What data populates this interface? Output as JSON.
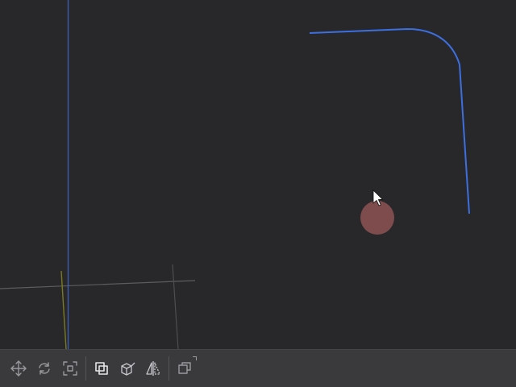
{
  "viewport": {
    "background": "#28282a",
    "axis_colors": {
      "z_axis": "#3a5db0",
      "y_axis": "#7a7a2a",
      "grid": "#5a5a5c"
    },
    "curve_color": "#3c6fe0",
    "click_marker_color": "#a05a5a"
  },
  "toolbar": {
    "tools": [
      {
        "name": "move-tool",
        "icon": "move-icon",
        "active": false
      },
      {
        "name": "rotate-tool",
        "icon": "rotate-icon",
        "active": false
      },
      {
        "name": "scale-tool",
        "icon": "scale-icon",
        "active": false
      },
      {
        "name": "boolean-tool",
        "icon": "boolean-icon",
        "active": true
      },
      {
        "name": "extrude-tool",
        "icon": "extrude-icon",
        "active": false
      },
      {
        "name": "mirror-tool",
        "icon": "mirror-icon",
        "active": false
      },
      {
        "name": "duplicate-tool",
        "icon": "duplicate-icon",
        "active": false
      }
    ]
  }
}
